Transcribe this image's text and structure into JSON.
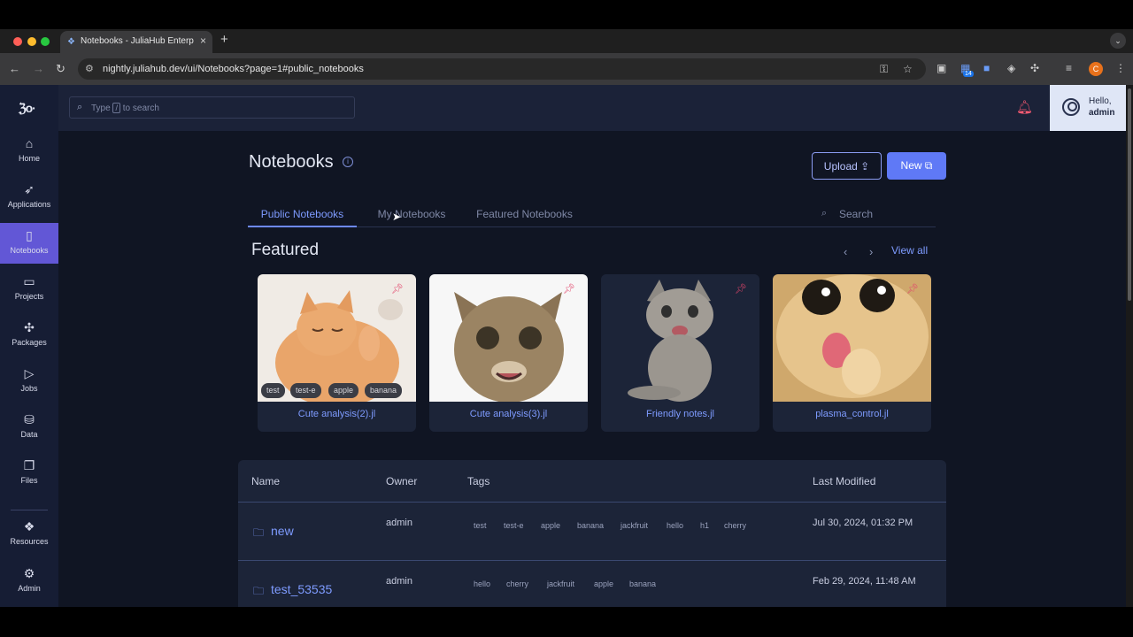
{
  "browser": {
    "tab_title": "Notebooks - JuliaHub Enterpr",
    "url": "nightly.juliahub.dev/ui/Notebooks?page=1#public_notebooks",
    "extension_badge": "14",
    "profile_initial": "C"
  },
  "sidebar": {
    "items": [
      {
        "label": "Home"
      },
      {
        "label": "Applications"
      },
      {
        "label": "Notebooks"
      },
      {
        "label": "Projects"
      },
      {
        "label": "Packages"
      },
      {
        "label": "Jobs"
      },
      {
        "label": "Data"
      },
      {
        "label": "Files"
      },
      {
        "label": "Resources"
      },
      {
        "label": "Admin"
      }
    ]
  },
  "topbar": {
    "search_prefix": "Type",
    "search_key": "/",
    "search_suffix": "to search",
    "greeting": "Hello,",
    "username": "admin"
  },
  "page": {
    "title": "Notebooks",
    "upload_label": "Upload",
    "new_label": "New"
  },
  "tabs": [
    {
      "label": "Public Notebooks"
    },
    {
      "label": "My Notebooks"
    },
    {
      "label": "Featured Notebooks"
    }
  ],
  "tab_search_placeholder": "Search",
  "featured": {
    "heading": "Featured",
    "view_all": "View all",
    "cards": [
      {
        "title": "Cute analysis(2).jl",
        "tags": [
          "test",
          "test-e",
          "apple",
          "banana"
        ]
      },
      {
        "title": "Cute analysis(3).jl"
      },
      {
        "title": "Friendly notes.jl"
      },
      {
        "title": "plasma_control.jl"
      }
    ]
  },
  "table": {
    "headers": {
      "name": "Name",
      "owner": "Owner",
      "tags": "Tags",
      "modified": "Last Modified"
    },
    "rows": [
      {
        "name": "new",
        "owner": "admin",
        "tags": [
          "test",
          "test-e",
          "apple",
          "banana",
          "jackfruit",
          "hello",
          "h1",
          "cherry"
        ],
        "modified": "Jul 30, 2024, 01:32 PM"
      },
      {
        "name": "test_53535",
        "owner": "admin",
        "tags": [
          "hello",
          "cherry",
          "jackfruit",
          "apple",
          "banana"
        ],
        "modified": "Feb 29, 2024, 11:48 AM"
      }
    ]
  },
  "colors": {
    "accent": "#5f79f6",
    "sidebar_active": "#6257d6",
    "background": "#101523",
    "pin": "#e2456b"
  }
}
